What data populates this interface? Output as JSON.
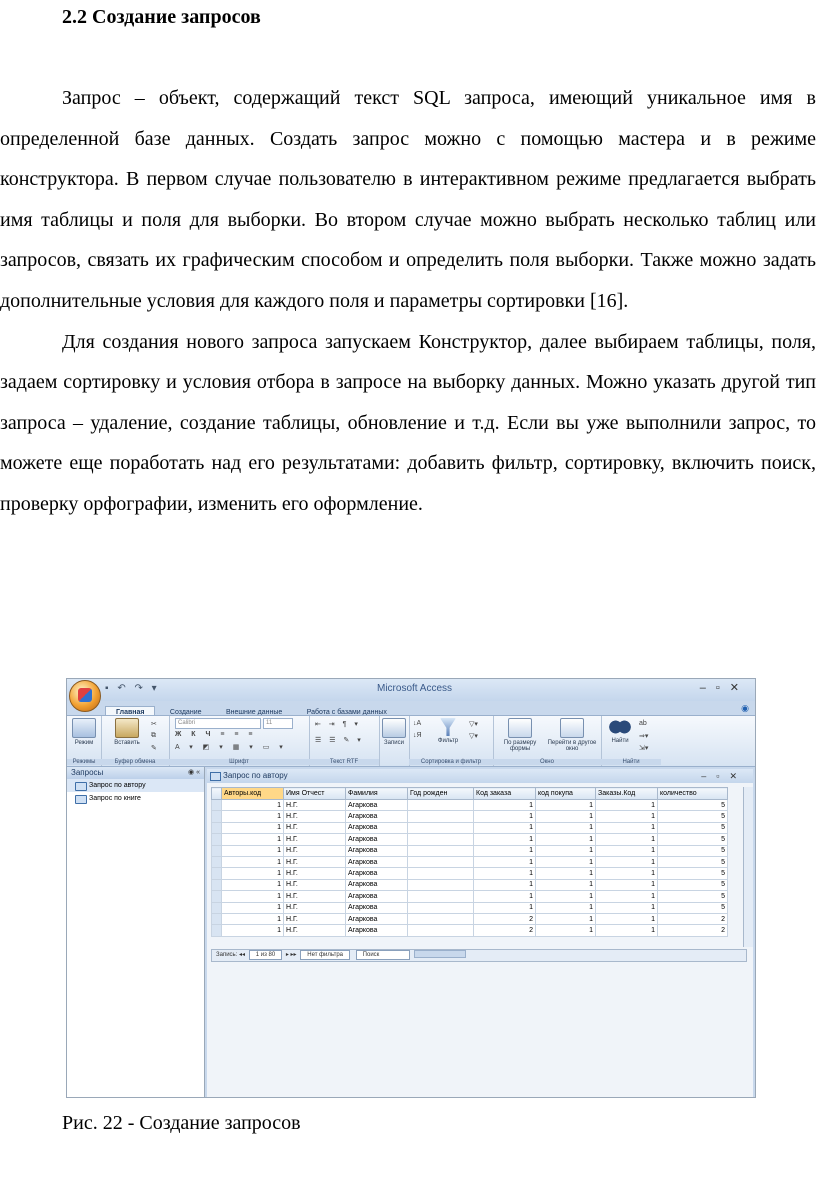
{
  "heading": "2.2 Создание запросов",
  "paragraphs": [
    "Запрос – объект, содержащий текст SQL запроса, имеющий уникальное имя в определенной базе данных. Создать запрос можно с помощью мастера и в режиме конструктора. В первом случае пользователю в интерактивном режиме предлагается выбрать имя таблицы и поля для выборки. Во втором случае можно выбрать несколько таблиц или запросов, связать их графическим способом и определить поля выборки. Также можно задать дополнительные условия для каждого поля и параметры сортировки [16].",
    "Для создания нового запроса запускаем Конструктор, далее выбираем таблицы, поля, задаем сортировку и условия отбора в запросе на выборку данных. Можно указать другой тип запроса – удаление, создание таблицы, обновление и т.д. Если вы уже выполнили запрос, то можете еще поработать над его результатами: добавить фильтр, сортировку, включить поиск, проверку орфографии, изменить его оформление."
  ],
  "figure": {
    "app_title": "Microsoft Access",
    "qat": "▪ ↶ ↷ ▾",
    "win_controls": "–▫✕",
    "ribbon_tabs": [
      "Главная",
      "Создание",
      "Внешние данные",
      "Работа с базами данных"
    ],
    "help": "◉",
    "groups": {
      "views": {
        "label": "Режимы",
        "btn": "Режим"
      },
      "clipboard": {
        "label": "Буфер обмена",
        "btn": "Вставить"
      },
      "font": {
        "label": "Шрифт",
        "font_name": "Calibri",
        "font_size": "11"
      },
      "rtf": {
        "label": "Текст RTF"
      },
      "records": {
        "label": "",
        "btn": "Записи"
      },
      "sort": {
        "label": "Сортировка и фильтр",
        "btn": "Фильтр"
      },
      "window": {
        "label": "Окно",
        "btn1": "По размеру формы",
        "btn2": "Перейти в другое окно"
      },
      "find": {
        "label": "Найти",
        "btn": "Найти"
      }
    },
    "nav": {
      "title": "Запросы",
      "controls": "◉ «",
      "items": [
        "Запрос по автору",
        "Запрос по книге"
      ]
    },
    "doc_tab": "Запрос по автору",
    "doc_controls": "–▫✕",
    "columns": [
      "Авторы.код",
      "Имя Отчест",
      "Фамилия",
      "Год рожден",
      "Код заказа",
      "код покупа",
      "Заказы.Код",
      "количество"
    ],
    "rows": [
      [
        "1",
        "Н.Г.",
        "Агаркова",
        "",
        "1",
        "1",
        "1",
        "5"
      ],
      [
        "1",
        "Н.Г.",
        "Агаркова",
        "",
        "1",
        "1",
        "1",
        "5"
      ],
      [
        "1",
        "Н.Г.",
        "Агаркова",
        "",
        "1",
        "1",
        "1",
        "5"
      ],
      [
        "1",
        "Н.Г.",
        "Агаркова",
        "",
        "1",
        "1",
        "1",
        "5"
      ],
      [
        "1",
        "Н.Г.",
        "Агаркова",
        "",
        "1",
        "1",
        "1",
        "5"
      ],
      [
        "1",
        "Н.Г.",
        "Агаркова",
        "",
        "1",
        "1",
        "1",
        "5"
      ],
      [
        "1",
        "Н.Г.",
        "Агаркова",
        "",
        "1",
        "1",
        "1",
        "5"
      ],
      [
        "1",
        "Н.Г.",
        "Агаркова",
        "",
        "1",
        "1",
        "1",
        "5"
      ],
      [
        "1",
        "Н.Г.",
        "Агаркова",
        "",
        "1",
        "1",
        "1",
        "5"
      ],
      [
        "1",
        "Н.Г.",
        "Агаркова",
        "",
        "1",
        "1",
        "1",
        "5"
      ],
      [
        "1",
        "Н.Г.",
        "Агаркова",
        "",
        "2",
        "1",
        "1",
        "2"
      ],
      [
        "1",
        "Н.Г.",
        "Агаркова",
        "",
        "2",
        "1",
        "1",
        "2"
      ]
    ],
    "recbar": {
      "label": "Запись:",
      "nav_first": "◂◂",
      "current": "1 из 80",
      "nav_next": "▸ ▸▸",
      "filter": "Нет фильтра",
      "search": "Поиск"
    }
  },
  "caption": "Рис. 22 - Создание запросов"
}
